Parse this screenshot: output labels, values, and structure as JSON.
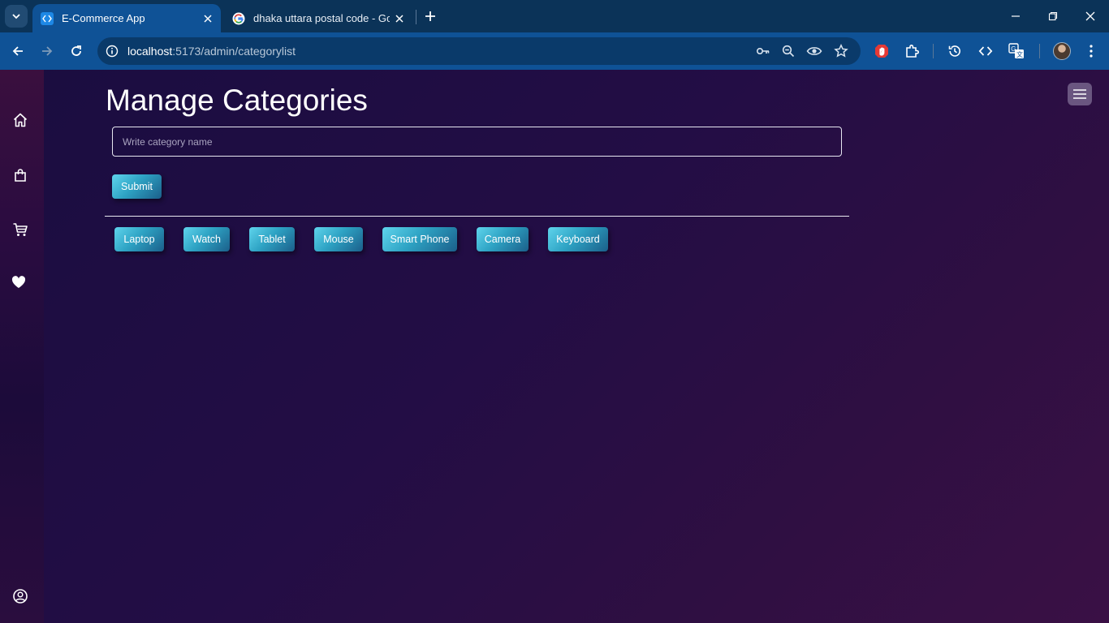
{
  "browser": {
    "tabs": [
      {
        "title": "E-Commerce App",
        "active": true
      },
      {
        "title": "dhaka uttara postal code - Goo",
        "active": false
      }
    ],
    "url": {
      "host": "localhost",
      "path": ":5173/admin/categorylist"
    }
  },
  "page": {
    "heading": "Manage Categories",
    "input": {
      "placeholder": "Write category name",
      "value": ""
    },
    "submit_label": "Submit",
    "categories": [
      "Laptop",
      "Watch",
      "Tablet",
      "Mouse",
      "Smart Phone",
      "Camera",
      "Keyboard"
    ]
  },
  "sidebar": {
    "icons": [
      "home-icon",
      "shopping-bag-icon",
      "cart-icon",
      "heart-icon",
      "user-circle-icon"
    ]
  },
  "colors": {
    "chrome_dark": "#0b3358",
    "chrome_active": "#0f5296",
    "page_bg": "#230d45",
    "button_gradient_start": "#5fd4ec",
    "button_gradient_end": "#1b5f8a"
  }
}
